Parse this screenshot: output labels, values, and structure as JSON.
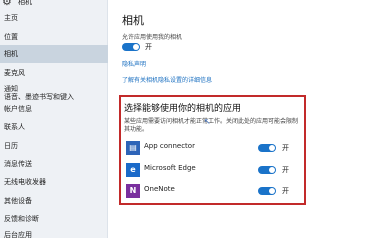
{
  "window": {
    "title": "相机"
  },
  "sidebar": {
    "items": [
      {
        "label": "主页"
      },
      {
        "label": "位置"
      },
      {
        "label": "相机"
      },
      {
        "label": "麦克风"
      },
      {
        "label": "通知"
      },
      {
        "label": "语音、墨迹书写和键入"
      },
      {
        "label": "帐户信息"
      },
      {
        "label": "联系人"
      },
      {
        "label": "日历"
      },
      {
        "label": "消息传送"
      },
      {
        "label": "无线电收发器"
      },
      {
        "label": "其他设备"
      },
      {
        "label": "反馈和诊断"
      },
      {
        "label": "后台应用"
      }
    ],
    "active_index": 2
  },
  "main": {
    "title": "相机",
    "allow_text": "允许应用使用我的相机",
    "master_toggle_label": "开",
    "privacy_link": "隐私声明",
    "more_link": "了解有关相机隐私设置的详细信息"
  },
  "apps_section": {
    "title": "选择能够使用你的相机的应用",
    "description": "某些应用需要访问相机才能正常工作。关闭此处的应用可能会限制其功能。",
    "apps": [
      {
        "name": "App connector",
        "toggle_label": "开",
        "icon": "app-connector-icon",
        "color": "#2d64b8"
      },
      {
        "name": "Microsoft Edge",
        "toggle_label": "开",
        "icon": "edge-icon",
        "color": "#1b6ac9"
      },
      {
        "name": "OneNote",
        "toggle_label": "开",
        "icon": "onenote-icon",
        "color": "#7a2f9e"
      }
    ]
  },
  "colors": {
    "accent": "#1a73c9",
    "highlight_border": "#c22a2a"
  }
}
